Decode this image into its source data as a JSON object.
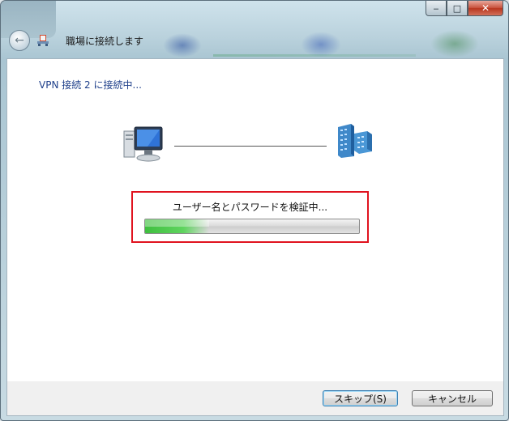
{
  "window": {
    "title": "職場に接続します",
    "caption": {
      "minimize": "‒",
      "maximize": "□",
      "close": "✕"
    }
  },
  "main": {
    "heading": "VPN 接続 2 に接続中...",
    "progress": {
      "label": "ユーザー名とパスワードを検証中...",
      "fraction": 0.3
    }
  },
  "footer": {
    "skip_label": "スキップ(S)",
    "cancel_label": "キャンセル"
  },
  "colors": {
    "highlight": "#e0131f",
    "heading": "#1e3f8a",
    "progress": "#3fbf3f"
  },
  "icons": {
    "back": "back-arrow-icon",
    "title": "network-connection-icon",
    "computer": "computer-icon",
    "server": "server-icon"
  }
}
